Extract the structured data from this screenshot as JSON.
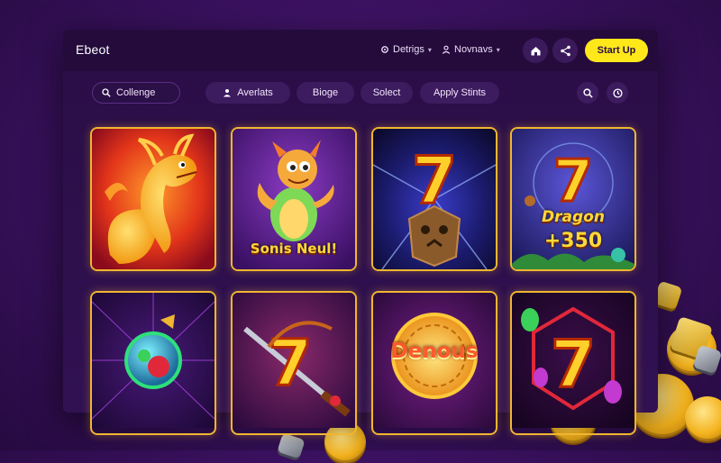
{
  "header": {
    "logo": "Ebeot",
    "nav": [
      {
        "label": "Detrigs",
        "icon": "gear-icon"
      },
      {
        "label": "Novnavs",
        "icon": "user-icon"
      }
    ],
    "home_icon": "home-icon",
    "share_icon": "share-icon",
    "cta_label": "Start Up"
  },
  "toolbar": {
    "search_value": "Collenge",
    "filters": [
      {
        "label": "Averlats",
        "icon": "person-icon"
      },
      {
        "label": "Bioge"
      },
      {
        "label": "Solect"
      },
      {
        "label": "Apply Stints"
      }
    ],
    "search_icon": "search-icon",
    "clock_icon": "clock-icon"
  },
  "games": [
    {
      "title": "",
      "art": "fire-dragon"
    },
    {
      "title": "Sonis Neul!",
      "art": "cartoon-dragon"
    },
    {
      "title": "",
      "art": "seven-stone-mask"
    },
    {
      "title": "Dragon",
      "sub": "+350",
      "art": "seven-dragon"
    },
    {
      "title": "",
      "art": "gem-orb"
    },
    {
      "title": "",
      "art": "seven-sword"
    },
    {
      "title": "Denous",
      "art": "denous-wheel"
    },
    {
      "title": "",
      "art": "seven-gems"
    }
  ],
  "colors": {
    "accent_yellow": "#ffe81a",
    "tile_border": "#f0b631",
    "window_bg": "#2a0e45"
  }
}
